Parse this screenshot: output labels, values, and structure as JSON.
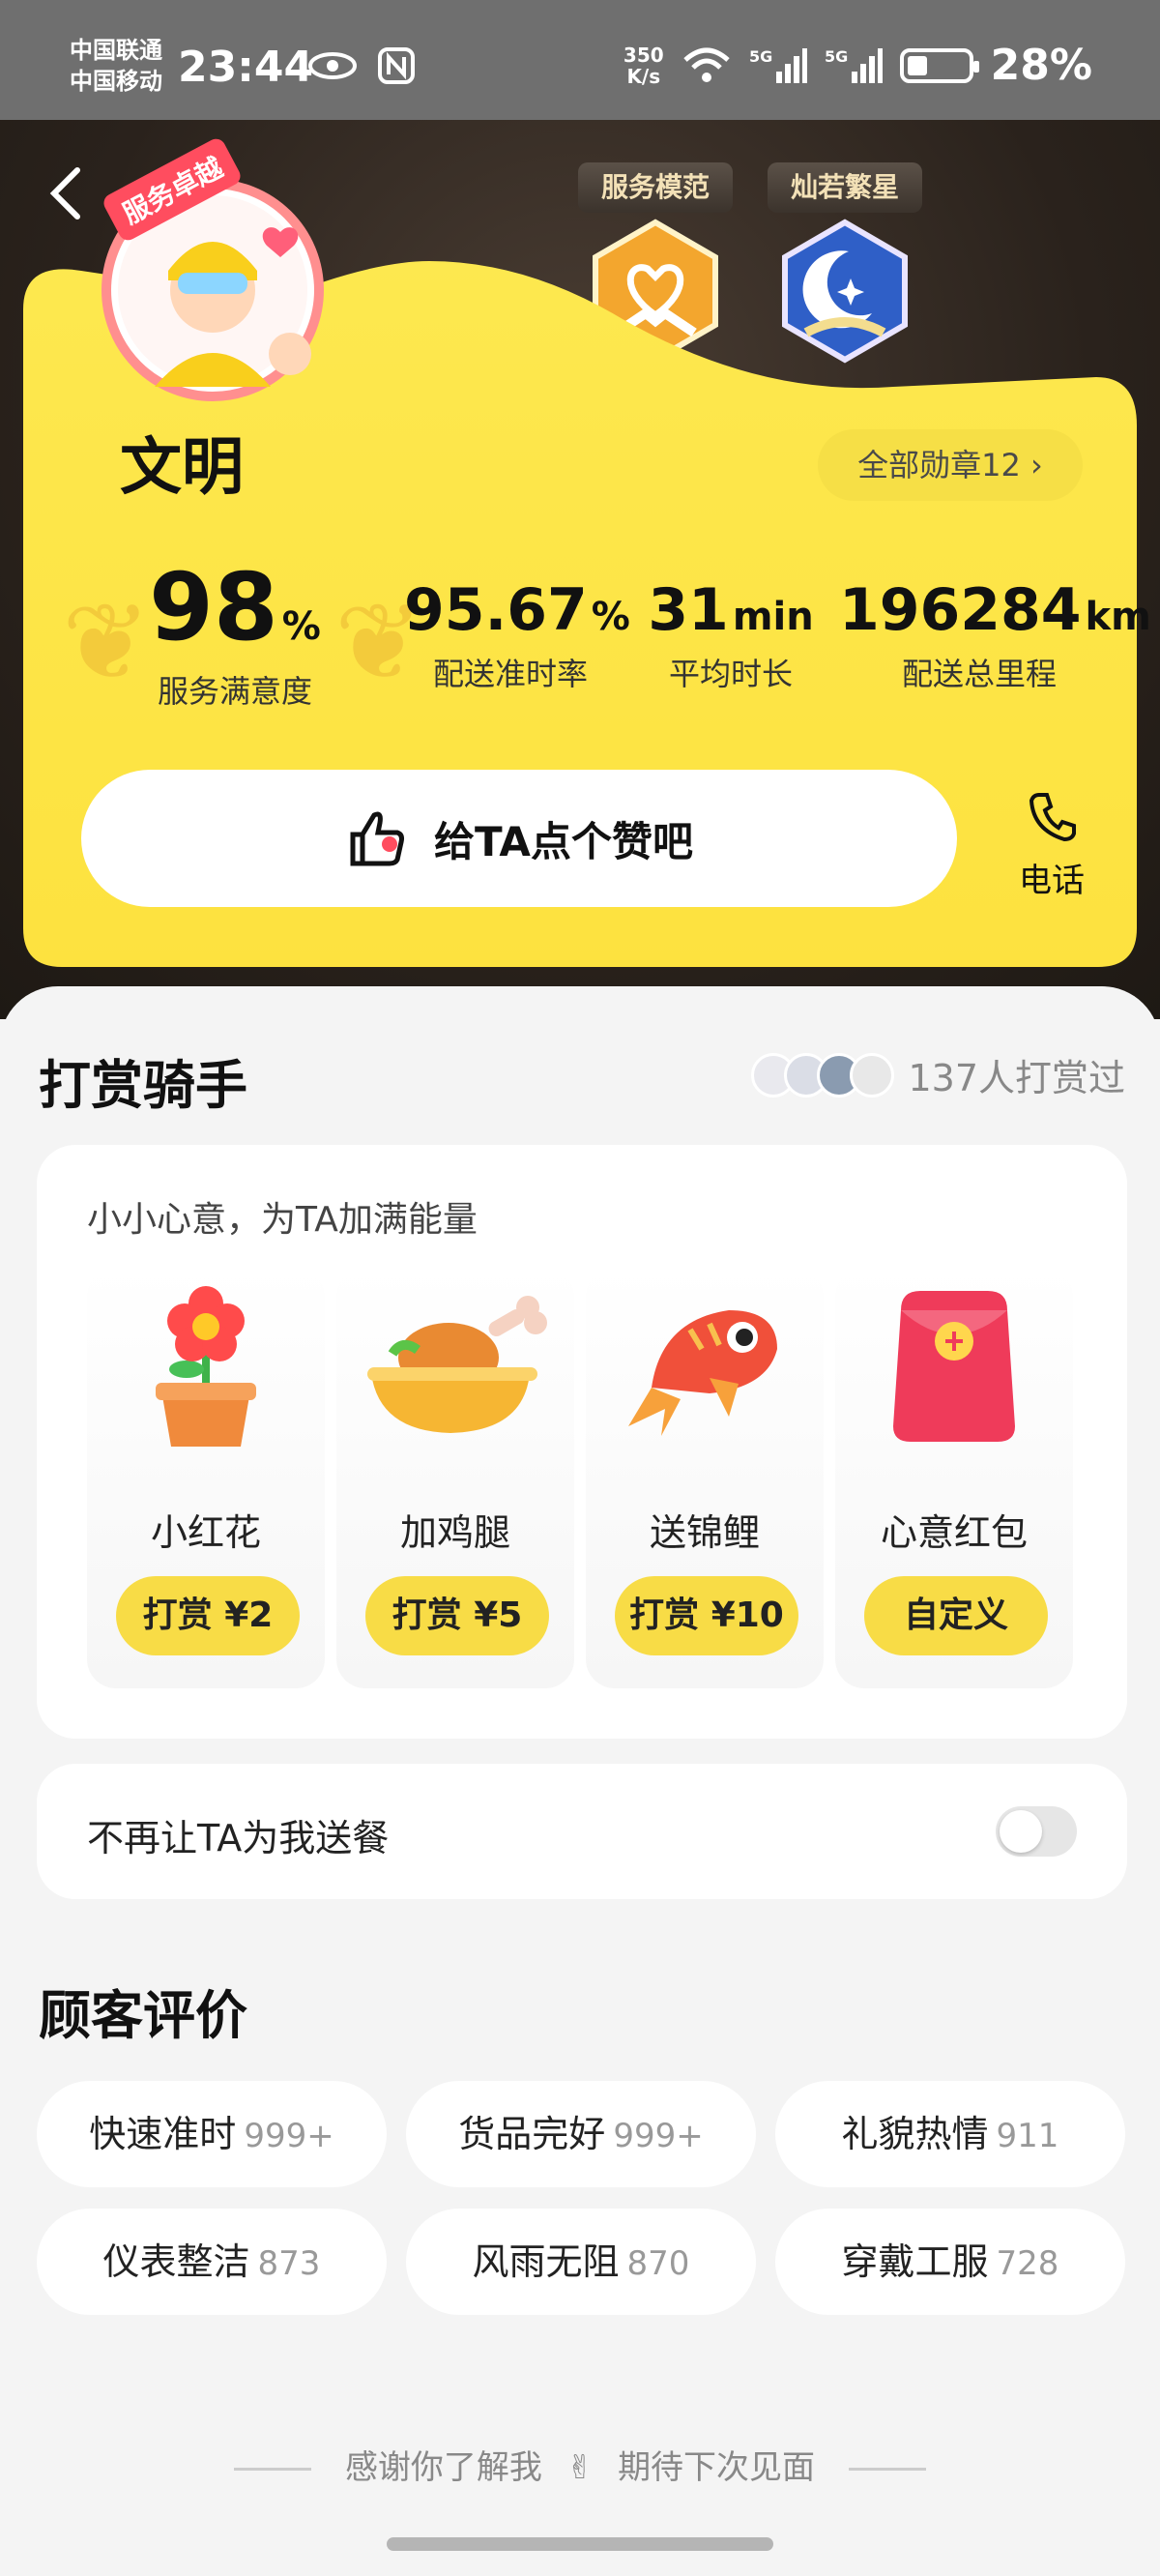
{
  "status_bar": {
    "carrier_1": "中国联通",
    "carrier_2": "中国移动",
    "time": "23:44",
    "net_speed_value": "350",
    "net_speed_unit": "K/s",
    "battery_pct": "28%"
  },
  "header": {
    "back_icon": "chevron-left-icon",
    "avatar_ribbon": "服务卓越",
    "badges": [
      {
        "label": "服务模范",
        "icon": "handshake-heart-icon"
      },
      {
        "label": "灿若繁星",
        "icon": "moon-stars-icon"
      }
    ]
  },
  "rider": {
    "name": "文明",
    "all_badges": "全部勋章12 ›"
  },
  "stats": [
    {
      "value": "98",
      "unit": "%",
      "label": "服务满意度"
    },
    {
      "value": "95.67",
      "unit": "%",
      "label": "配送准时率"
    },
    {
      "value": "31",
      "unit": "min",
      "label": "平均时长"
    },
    {
      "value": "196284",
      "unit": "km",
      "label": "配送总里程"
    }
  ],
  "actions": {
    "like_label": "给TA点个赞吧",
    "phone_label": "电话"
  },
  "tip": {
    "title": "打赏骑手",
    "tippers_count": "137人打赏过",
    "subtitle": "小小心意，为TA加满能量",
    "gifts": [
      {
        "name": "小红花",
        "button": "打赏 ¥2",
        "icon": "flower-pot-icon"
      },
      {
        "name": "加鸡腿",
        "button": "打赏 ¥5",
        "icon": "drumstick-bowl-icon"
      },
      {
        "name": "送锦鲤",
        "button": "打赏 ¥10",
        "icon": "koi-fish-icon"
      },
      {
        "name": "心意红包",
        "button": "自定义",
        "icon": "red-envelope-icon"
      }
    ]
  },
  "block_rider": {
    "label": "不再让TA为我送餐",
    "enabled": false
  },
  "reviews": {
    "title": "顾客评价",
    "tags": [
      {
        "label": "快速准时",
        "count": "999+"
      },
      {
        "label": "货品完好",
        "count": "999+"
      },
      {
        "label": "礼貌热情",
        "count": "911"
      },
      {
        "label": "仪表整洁",
        "count": "873"
      },
      {
        "label": "风雨无阻",
        "count": "870"
      },
      {
        "label": "穿戴工服",
        "count": "728"
      }
    ]
  },
  "footer": {
    "left": "感谢你了解我",
    "right": "期待下次见面"
  },
  "colors": {
    "accent_yellow": "#f8dc46",
    "card_yellow": "#fbe645"
  }
}
